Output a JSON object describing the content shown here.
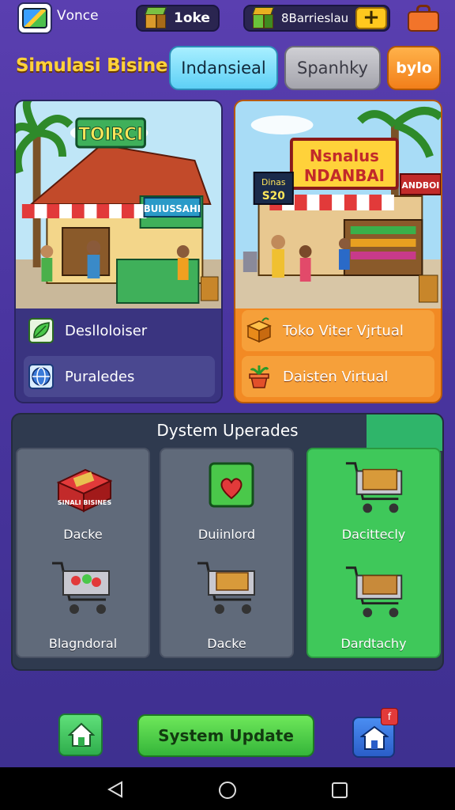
{
  "top_bar": {
    "app_name": "Vоnce",
    "resource1": "1oke",
    "resource2": "8Barrieslau",
    "add_label": "+"
  },
  "header": {
    "title": "Simulasi Bisineis",
    "tabs": [
      {
        "label": "Indansieal",
        "state": "active"
      },
      {
        "label": "Spanhky",
        "state": "inactive"
      },
      {
        "label": "bylo",
        "state": "highlight"
      }
    ]
  },
  "card_left": {
    "shop_sign": "TOIRCI",
    "stall_sign": "BUIUSSAHI",
    "rows": [
      {
        "label": "Deslloloiser",
        "icon": "leaf-icon"
      },
      {
        "label": "Puraledes",
        "icon": "globe-icon"
      }
    ]
  },
  "card_right": {
    "sign_main_1": "Nsnalus",
    "sign_main_2": "NDANBAI",
    "sign_price_1": "Dinas",
    "sign_price_2": "S20",
    "sign_side": "ANDBOI",
    "rows": [
      {
        "label": "Toko Viter Vjrtual",
        "icon": "crate-icon"
      },
      {
        "label": "Daisten Virtual",
        "icon": "plant-pot-icon"
      }
    ]
  },
  "upgrades": {
    "title": "Dystem Uperades",
    "crate_text": "SINALI BISINES",
    "tiles": [
      {
        "top_label": "Dacke",
        "bottom_label": "Blagndoral",
        "state": "locked"
      },
      {
        "top_label": "Duiinlord",
        "bottom_label": "Dacke",
        "state": "locked"
      },
      {
        "top_label": "Dacittecly",
        "bottom_label": "Dardtachy",
        "state": "active"
      }
    ]
  },
  "bottom": {
    "update_button": "System Update",
    "notification": "f"
  },
  "colors": {
    "background": "#4a35a0",
    "title": "#ffd23a",
    "active_tab": "#5ed0f6",
    "orange_card": "#f28a24",
    "green_action": "#3fc85a"
  }
}
